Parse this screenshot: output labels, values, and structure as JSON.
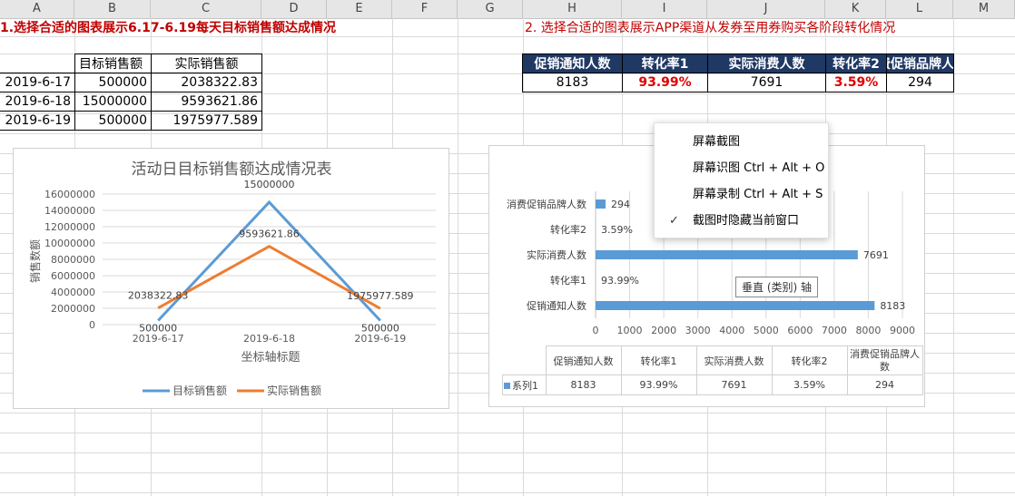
{
  "columns": [
    "A",
    "B",
    "C",
    "D",
    "E",
    "F",
    "G",
    "H",
    "I",
    "J",
    "K",
    "L",
    "M"
  ],
  "task1_title": "1.选择合适的图表展示6.17-6.19每天目标销售额达成情况",
  "task2_title": "2. 选择合适的图表展示APP渠道从发券至用券购买各阶段转化情况",
  "table1": {
    "headers": [
      "目标销售额",
      "实际销售额"
    ],
    "rows": [
      {
        "date": "2019-6-17",
        "target": "500000",
        "actual": "2038322.83"
      },
      {
        "date": "2019-6-18",
        "target": "15000000",
        "actual": "9593621.86"
      },
      {
        "date": "2019-6-19",
        "target": "500000",
        "actual": "1975977.589"
      }
    ]
  },
  "table2": {
    "headers": [
      "促销通知人数",
      "转化率1",
      "实际消费人数",
      "转化率2",
      "消费促销品牌人"
    ],
    "values": [
      "8183",
      "93.99%",
      "7691",
      "3.59%",
      "294"
    ]
  },
  "chart_data": [
    {
      "type": "line",
      "title": "活动日目标销售额达成情况表",
      "xlabel": "坐标轴标题",
      "ylabel": "销售数额",
      "categories": [
        "2019-6-17",
        "2019-6-18",
        "2019-6-19"
      ],
      "ylim": [
        0,
        16000000
      ],
      "yticks": [
        "16000000",
        "14000000",
        "12000000",
        "10000000",
        "8000000",
        "6000000",
        "4000000",
        "2000000",
        "0"
      ],
      "series": [
        {
          "name": "目标销售额",
          "values": [
            500000,
            15000000,
            500000
          ],
          "labels": [
            "500000",
            "15000000",
            "500000"
          ],
          "color": "#5b9bd5"
        },
        {
          "name": "实际销售额",
          "values": [
            2038322.83,
            9593621.86,
            1975977.589
          ],
          "labels": [
            "2038322.83",
            "9593621.86",
            "1975977.589"
          ],
          "color": "#ed7d31"
        }
      ],
      "legend": "bottom"
    },
    {
      "type": "bar",
      "orientation": "horizontal",
      "categories": [
        "促销通知人数",
        "转化率1",
        "实际消费人数",
        "转化率2",
        "消费促销品牌人数"
      ],
      "values": [
        8183,
        0.9399,
        7691,
        0.0359,
        294
      ],
      "labels": [
        "8183",
        "93.99%",
        "7691",
        "3.59%",
        "294"
      ],
      "xlim": [
        0,
        9000
      ],
      "xticks": [
        "0",
        "1000",
        "2000",
        "3000",
        "4000",
        "5000",
        "6000",
        "7000",
        "8000",
        "9000"
      ],
      "color": "#5b9bd5",
      "data_table": {
        "headers": [
          "促销通知人数",
          "转化率1",
          "实际消费人数",
          "转化率2",
          "消费促销品牌人数"
        ],
        "series_name": "系列1",
        "values": [
          "8183",
          "93.99%",
          "7691",
          "3.59%",
          "294"
        ]
      }
    }
  ],
  "context_menu": {
    "items": [
      "屏幕截图",
      "屏幕识图 Ctrl + Alt + O",
      "屏幕录制 Ctrl + Alt + S",
      "截图时隐藏当前窗口"
    ],
    "checked": "✓"
  },
  "tooltip": "垂直 (类别) 轴"
}
